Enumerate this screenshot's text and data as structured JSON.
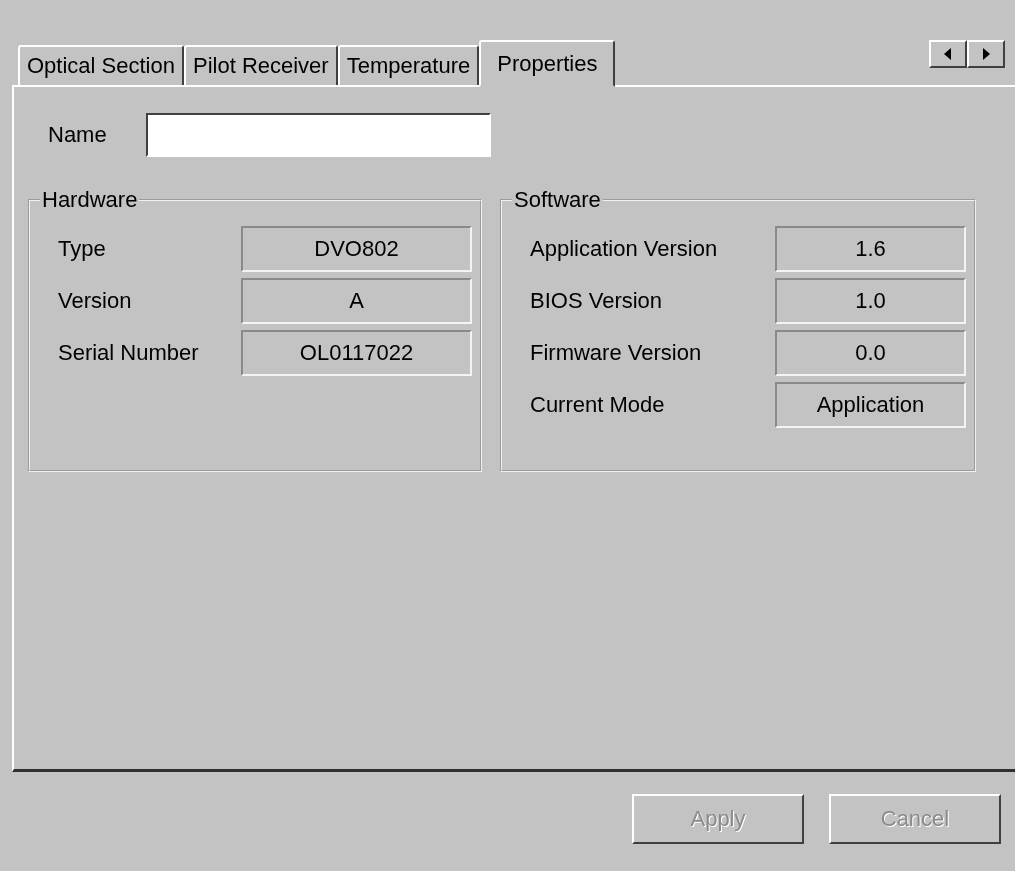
{
  "tabs": [
    {
      "label": "Optical Section",
      "selected": false
    },
    {
      "label": "Pilot Receiver",
      "selected": false
    },
    {
      "label": "Temperature",
      "selected": false
    },
    {
      "label": "Properties",
      "selected": true
    }
  ],
  "name_field": {
    "label": "Name"
  },
  "groups": [
    {
      "title": "Hardware",
      "rows": [
        {
          "label": "Type",
          "value": "DVO802"
        },
        {
          "label": "Version",
          "value": "A"
        },
        {
          "label": "Serial Number",
          "value": "OL0117022"
        }
      ]
    },
    {
      "title": "Software",
      "rows": [
        {
          "label": "Application Version",
          "value": "1.6"
        },
        {
          "label": "BIOS Version",
          "value": "1.0"
        },
        {
          "label": "Firmware Version",
          "value": "0.0"
        },
        {
          "label": "Current Mode",
          "value": "Application"
        }
      ]
    }
  ],
  "buttons": [
    {
      "label": "Apply",
      "disabled": true
    },
    {
      "label": "Cancel",
      "disabled": true
    }
  ]
}
